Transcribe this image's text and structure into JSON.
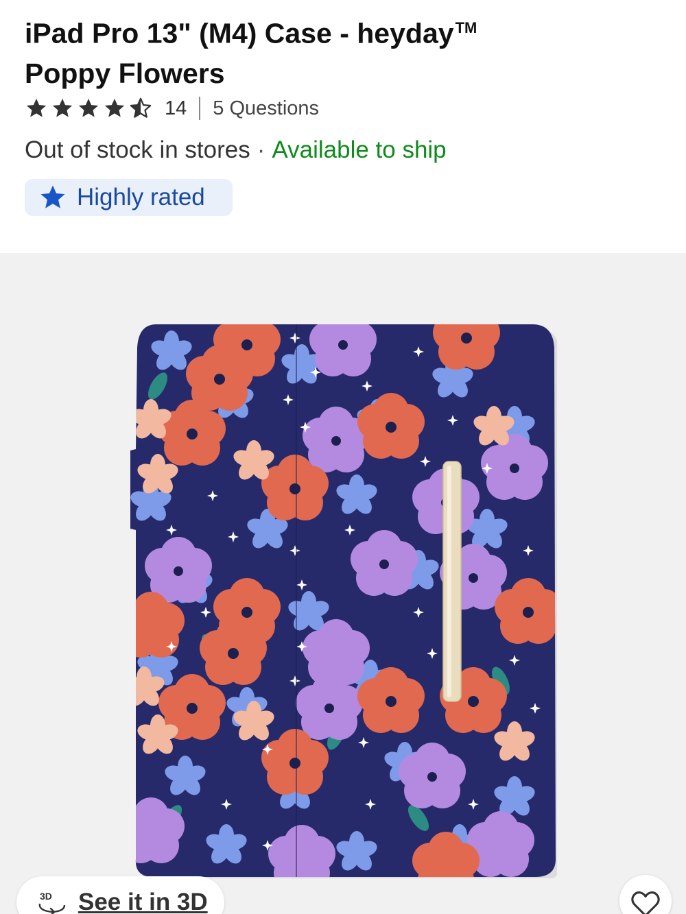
{
  "product": {
    "title": "iPad Pro 13\" (M4) Case - heyday",
    "trademark": "TM",
    "title_line2": "Poppy Flowers"
  },
  "rating": {
    "value": 4.5,
    "max": 5,
    "count": "14",
    "questions": "5 Questions"
  },
  "availability": {
    "store": "Out of stock in stores",
    "separator": "·",
    "ship": "Available to ship",
    "ship_color": "#108a1c"
  },
  "badge": {
    "icon": "star-icon",
    "label": "Highly rated",
    "color": "#1a4aa0"
  },
  "image": {
    "description": "floral pattern tablet folio case",
    "colors": [
      "#2a2f6e",
      "#e0694f",
      "#b48ae0",
      "#7c9be8",
      "#f2b8a0",
      "#2c8c84"
    ]
  },
  "actions": {
    "view_3d_icon": "3d-rotate-icon",
    "view_3d_label": "See it in 3D",
    "favorite_icon": "heart-icon"
  }
}
